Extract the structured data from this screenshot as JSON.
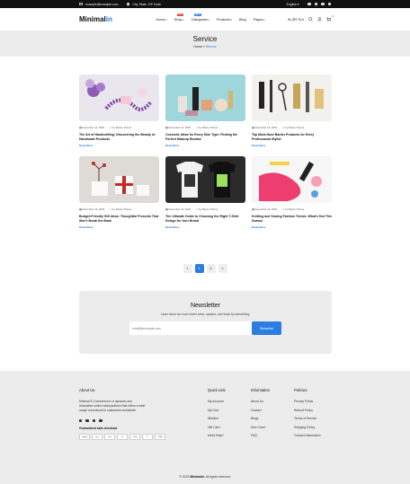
{
  "topbar": {
    "email": "example@example.com",
    "address": "City, State, ZIP Code",
    "language": "English",
    "currency": "IN (RS ₹)"
  },
  "header": {
    "logo_main": "Minimal",
    "logo_accent": "in",
    "nav": [
      {
        "label": "Home",
        "badge": ""
      },
      {
        "label": "Shop",
        "badge": "HOT"
      },
      {
        "label": "Categories",
        "badge": "NEW"
      },
      {
        "label": "Products",
        "badge": ""
      },
      {
        "label": "Blog",
        "badge": ""
      },
      {
        "label": "Pages",
        "badge": ""
      }
    ],
    "cart_count": "0"
  },
  "page": {
    "title": "Service",
    "breadcrumb_home": "Home",
    "breadcrumb_sep": "»",
    "breadcrumb_current": "Service"
  },
  "posts": [
    {
      "date": "November 13, 2023",
      "author": "by Marco Theme",
      "title": "The Art of Handcrafting: Discovering the Beauty of Handmade Products",
      "read": "Read More",
      "image": "beads-flowers"
    },
    {
      "date": "November 13, 2023",
      "author": "by Marco Theme",
      "title": "Cosmetic Ideas for Every Skin Type: Finding the Perfect Makeup Routine",
      "read": "Read More",
      "image": "cosmetics"
    },
    {
      "date": "November 13, 2023",
      "author": "by Marco Theme",
      "title": "Top Must-Have Barber Products for Every Professional Stylist",
      "read": "Read More",
      "image": "barber-tools"
    },
    {
      "date": "November 13, 2023",
      "author": "by Marco Theme",
      "title": "Budget-Friendly Gift Ideas: Thoughtful Presents That Won't Break the Bank",
      "read": "Read More",
      "image": "gift-boxes"
    },
    {
      "date": "November 13, 2023",
      "author": "by Marco Theme",
      "title": "The Ultimate Guide to Choosing the Right T-Shirt Design for Your Brand",
      "read": "Read More",
      "image": "tshirts"
    },
    {
      "date": "November 13, 2023",
      "author": "by Marco Theme",
      "title": "Knitting and Sewing Fashion Trends: What's Hot This Season",
      "read": "Read More",
      "image": "sewing"
    }
  ],
  "pagination": {
    "prev": "«",
    "pages": [
      "1",
      "2"
    ],
    "next": "»",
    "active": "1"
  },
  "newsletter": {
    "title": "Newsletter",
    "text": "Learn about our most recent news, updates, and deals by subscribing.",
    "placeholder": "email@example.com",
    "button": "Subscribe"
  },
  "footer": {
    "about_title": "About Us.",
    "about_text": "Minimal E-Commerce is a dynamic and innovative online retail platform that offers a wide range of products to customers worldwide.",
    "guarantee": "Guaranteed safe checkout",
    "payments": [
      "shopify",
      "Pay",
      "Pay",
      "B",
      "G Pay",
      "P",
      "VISA"
    ],
    "cols": [
      {
        "title": "Quick Link",
        "links": [
          "My Account",
          "My Cart",
          "Wishlist",
          "Gift Card",
          "Need Help?"
        ]
      },
      {
        "title": "Information",
        "links": [
          "About Us",
          "Contact",
          "Blogs",
          "Size Chart",
          "FAQ"
        ]
      },
      {
        "title": "Policies",
        "links": [
          "Privacy Policy",
          "Refund Policy",
          "Terms of Service",
          "Shipping Policy",
          "Contact Information"
        ]
      }
    ],
    "copyright_pre": "© 2023",
    "copyright_brand": "Minimalin.",
    "copyright_post": "All rights reserved."
  },
  "colors": {
    "accent": "#2a7de1",
    "hot_badge": "#e53935",
    "new_badge": "#2a7de1"
  }
}
